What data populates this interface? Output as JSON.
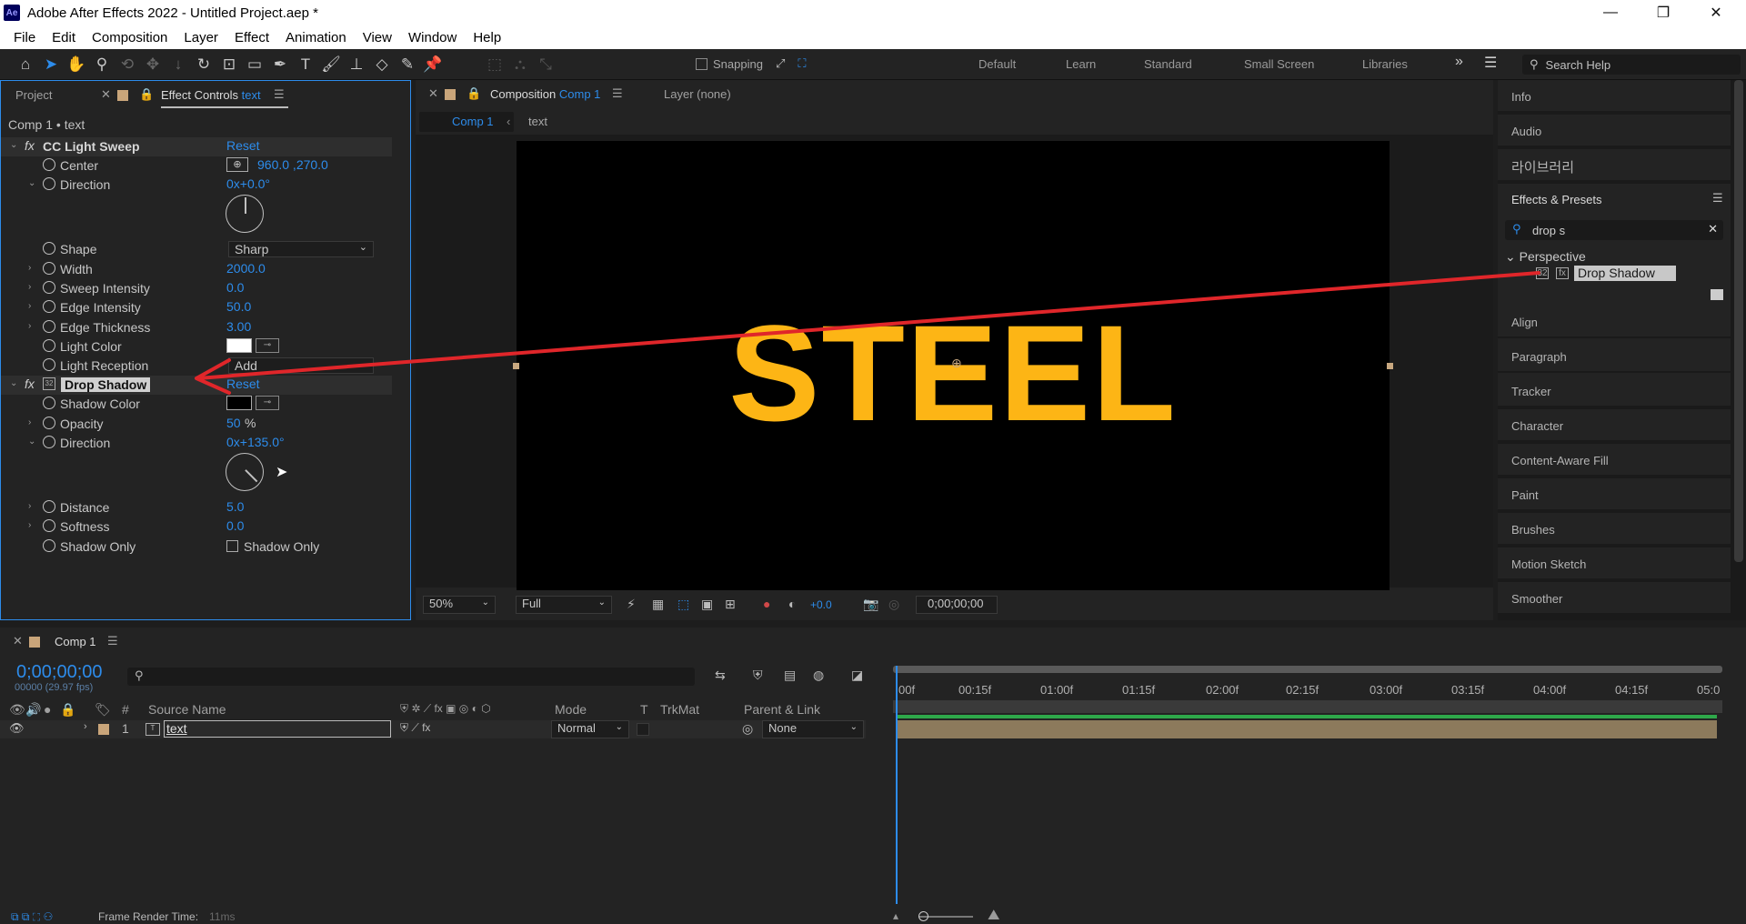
{
  "window": {
    "title": "Adobe After Effects 2022 - Untitled Project.aep *",
    "logo": "Ae",
    "controls": {
      "minimize": "—",
      "restore": "❐",
      "close": "✕"
    }
  },
  "menu": [
    "File",
    "Edit",
    "Composition",
    "Layer",
    "Effect",
    "Animation",
    "View",
    "Window",
    "Help"
  ],
  "toolbar": {
    "snapping_label": "Snapping",
    "workspaces": [
      "Default",
      "Learn",
      "Standard",
      "Small Screen",
      "Libraries"
    ],
    "search_placeholder": "Search Help"
  },
  "effect_controls": {
    "tab_project": "Project",
    "tab_prefix": "Effect Controls",
    "tab_layer": "text",
    "subtitle": "Comp 1 • text",
    "light_sweep": {
      "name": "CC Light Sweep",
      "reset": "Reset",
      "center_label": "Center",
      "center_value": "960.0 ,270.0",
      "direction_label": "Direction",
      "direction_value": "0x+0.0°",
      "shape_label": "Shape",
      "shape_value": "Sharp",
      "width_label": "Width",
      "width_value": "2000.0",
      "sweep_intensity_label": "Sweep Intensity",
      "sweep_intensity_value": "0.0",
      "edge_intensity_label": "Edge Intensity",
      "edge_intensity_value": "50.0",
      "edge_thickness_label": "Edge Thickness",
      "edge_thickness_value": "3.00",
      "light_color_label": "Light Color",
      "light_reception_label": "Light Reception",
      "light_reception_value": "Add"
    },
    "drop_shadow": {
      "name": "Drop Shadow",
      "reset": "Reset",
      "shadow_color_label": "Shadow Color",
      "opacity_label": "Opacity",
      "opacity_value": "50",
      "opacity_unit": "%",
      "direction_label": "Direction",
      "direction_value": "0x+135.0°",
      "distance_label": "Distance",
      "distance_value": "5.0",
      "softness_label": "Softness",
      "softness_value": "0.0",
      "shadow_only_label": "Shadow Only",
      "shadow_only_checkbox": "Shadow Only"
    }
  },
  "composition": {
    "tab_prefix": "Composition",
    "tab_comp": "Comp 1",
    "layer_tab": "Layer (none)",
    "breadcrumb_comp": "Comp 1",
    "breadcrumb_layer": "text",
    "canvas_text": "STEEL",
    "zoom": "50%",
    "resolution": "Full",
    "exposure": "+0.0",
    "timecode": "0;00;00;00"
  },
  "right_panels": {
    "info": "Info",
    "audio": "Audio",
    "libraries": "라이브러리",
    "effects_presets": "Effects & Presets",
    "search_value": "drop s",
    "category": "Perspective",
    "result": "Drop Shadow",
    "align": "Align",
    "paragraph": "Paragraph",
    "tracker": "Tracker",
    "character": "Character",
    "content_aware_fill": "Content-Aware Fill",
    "paint": "Paint",
    "brushes": "Brushes",
    "motion_sketch": "Motion Sketch",
    "smoother": "Smoother"
  },
  "timeline": {
    "tab": "Comp 1",
    "time": "0;00;00;00",
    "fps": "00000 (29.97 fps)",
    "columns": {
      "num": "#",
      "source": "Source Name",
      "mode": "Mode",
      "t": "T",
      "trkmat": "TrkMat",
      "parent": "Parent & Link"
    },
    "layer": {
      "index": "1",
      "name": "text",
      "mode": "Normal",
      "parent": "None"
    },
    "ticks": [
      "00f",
      "00:15f",
      "01:00f",
      "01:15f",
      "02:00f",
      "02:15f",
      "03:00f",
      "03:15f",
      "04:00f",
      "04:15f",
      "05:0"
    ]
  },
  "status": {
    "frame_render_label": "Frame Render Time:",
    "frame_render_value": "11ms"
  },
  "colors": {
    "accent": "#2d8ceb",
    "text_fill": "#fdb515",
    "arrow": "#e0262a"
  }
}
